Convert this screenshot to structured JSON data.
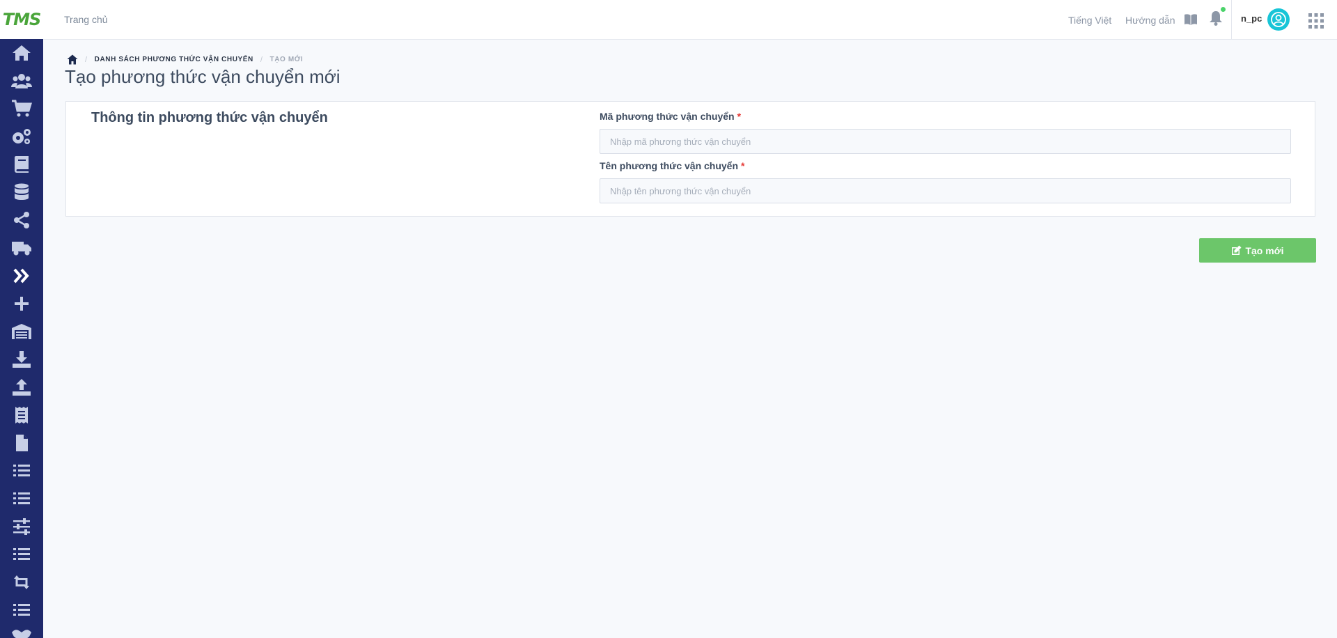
{
  "brand": {
    "logo_text": "TMS"
  },
  "topbar": {
    "home_label": "Trang chủ",
    "language": "Tiếng Việt",
    "guide": "Hướng dẫn",
    "username": "n_pc"
  },
  "sidebar": {
    "items": [
      {
        "icon": "home-icon"
      },
      {
        "icon": "users-icon"
      },
      {
        "icon": "cart-icon"
      },
      {
        "icon": "gears-icon"
      },
      {
        "icon": "book-icon"
      },
      {
        "icon": "database-icon"
      },
      {
        "icon": "share-icon"
      },
      {
        "icon": "truck-icon"
      },
      {
        "icon": "double-chevron-right-icon",
        "active": true
      },
      {
        "icon": "plus-icon"
      },
      {
        "icon": "warehouse-icon"
      },
      {
        "icon": "download-icon"
      },
      {
        "icon": "upload-icon"
      },
      {
        "icon": "receipt-icon"
      },
      {
        "icon": "file-icon"
      },
      {
        "icon": "list-icon"
      },
      {
        "icon": "list-icon"
      },
      {
        "icon": "sliders-icon"
      },
      {
        "icon": "list-icon"
      },
      {
        "icon": "retweet-icon"
      },
      {
        "icon": "list-icon"
      },
      {
        "icon": "handshake-icon"
      }
    ]
  },
  "breadcrumb": {
    "parent": "DANH SÁCH PHƯƠNG THỨC VẬN CHUYỂN",
    "current": "TẠO MỚI"
  },
  "page": {
    "title": "Tạo phương thức vận chuyển mới"
  },
  "form": {
    "section_title": "Thông tin phương thức vận chuyển",
    "code": {
      "label": "Mã phương thức vận chuyển",
      "required_mark": "*",
      "placeholder": "Nhập mã phương thức vận chuyển",
      "value": ""
    },
    "name": {
      "label": "Tên phương thức vận chuyển",
      "required_mark": "*",
      "placeholder": "Nhập tên phương thức vận chuyển",
      "value": ""
    },
    "submit_label": "Tạo mới"
  },
  "colors": {
    "sidebar": "#1f2a6c",
    "accent_green": "#6cc66a",
    "avatar": "#18c5d7",
    "required": "#e53935"
  }
}
